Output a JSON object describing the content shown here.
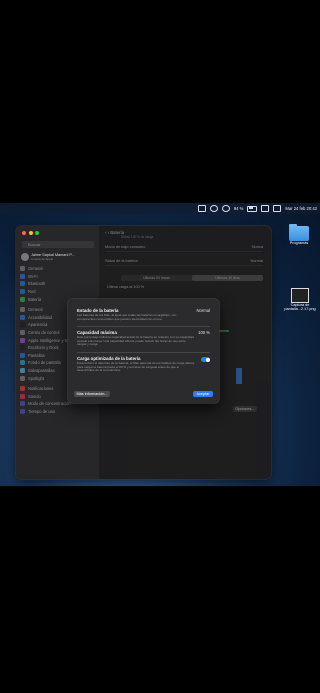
{
  "menubar": {
    "battery_percent": "94 %",
    "datetime": "Mar 24 feb 20:42"
  },
  "desktop": {
    "folder_label": "Programas",
    "screenshot_label": "Captura de pantalla...2.17.png"
  },
  "sidebar": {
    "search_placeholder": "Buscar",
    "user_name": "Jaime Sapkal Mamani P...",
    "user_sub": "Cuenta de Apple",
    "items": [
      {
        "label": "General",
        "color": "#8e8e93"
      },
      {
        "label": "Wi-Fi",
        "color": "#2f7cf6"
      },
      {
        "label": "Bluetooth",
        "color": "#2f7cf6"
      },
      {
        "label": "Red",
        "color": "#2f7cf6"
      },
      {
        "label": "Batería",
        "color": "#34c759"
      },
      {
        "label": "General",
        "color": "#8e8e93"
      },
      {
        "label": "Accesibilidad",
        "color": "#2f7cf6"
      },
      {
        "label": "Apariencia",
        "color": "#1c1c1e"
      },
      {
        "label": "Centro de control",
        "color": "#8e8e93"
      },
      {
        "label": "Apple Intelligence y Siri",
        "color": "#af52de"
      },
      {
        "label": "Escritorio y Dock",
        "color": "#1c1c1e"
      },
      {
        "label": "Pantallas",
        "color": "#2f7cf6"
      },
      {
        "label": "Fondo de pantalla",
        "color": "#34aadc"
      },
      {
        "label": "Salvapantallas",
        "color": "#5ac8fa"
      },
      {
        "label": "Spotlight",
        "color": "#8e8e93"
      },
      {
        "label": "Notificaciones",
        "color": "#ff3b30"
      },
      {
        "label": "Sonido",
        "color": "#ff2d55"
      },
      {
        "label": "Modo de concentración",
        "color": "#5856d6"
      },
      {
        "label": "Tiempo de uso",
        "color": "#5856d6"
      }
    ]
  },
  "main": {
    "title": "Batería",
    "subtitle": "Último 100 % de carga",
    "low_power_label": "Modo de bajo consumo",
    "low_power_value": "Nunca",
    "health_label": "Salud de la batería",
    "health_value": "Normal",
    "tabs": [
      "Últimas 24 horas",
      "Últimos 10 días"
    ],
    "last_charge": "Última carga al 100 %",
    "level_label": "Nivel de batería",
    "options_button": "Opciones..."
  },
  "sheet": {
    "s1_title": "Estado de la batería",
    "s1_value": "Normal",
    "s1_desc": "Las baterías de los Mac, al igual que todas las baterías recargables, son componentes consumibles que pierden efectividad con el uso.",
    "s2_title": "Capacidad máxima",
    "s2_value": "100 %",
    "s2_desc": "Este porcentaje indica la capacidad actual de la batería en relación con su capacidad cuando era nueva. Una capacidad inferior puede reducir las horas de uso entre cargas y carga.",
    "s3_title": "Carga optimizada de la batería",
    "s3_desc": "Para reducir el deterioro de la batería, el Mac aprende de tus hábitos de carga diarios para cargar la batería hasta el 80 % y terminar de cargarla antes de que lo desenchufes de la red eléctrica.",
    "toggle_on": true,
    "more_info": "Más información...",
    "accept": "Aceptar"
  },
  "colors": {
    "accent": "#2f7cf6",
    "sheet_bg": "#2b2b2d"
  }
}
